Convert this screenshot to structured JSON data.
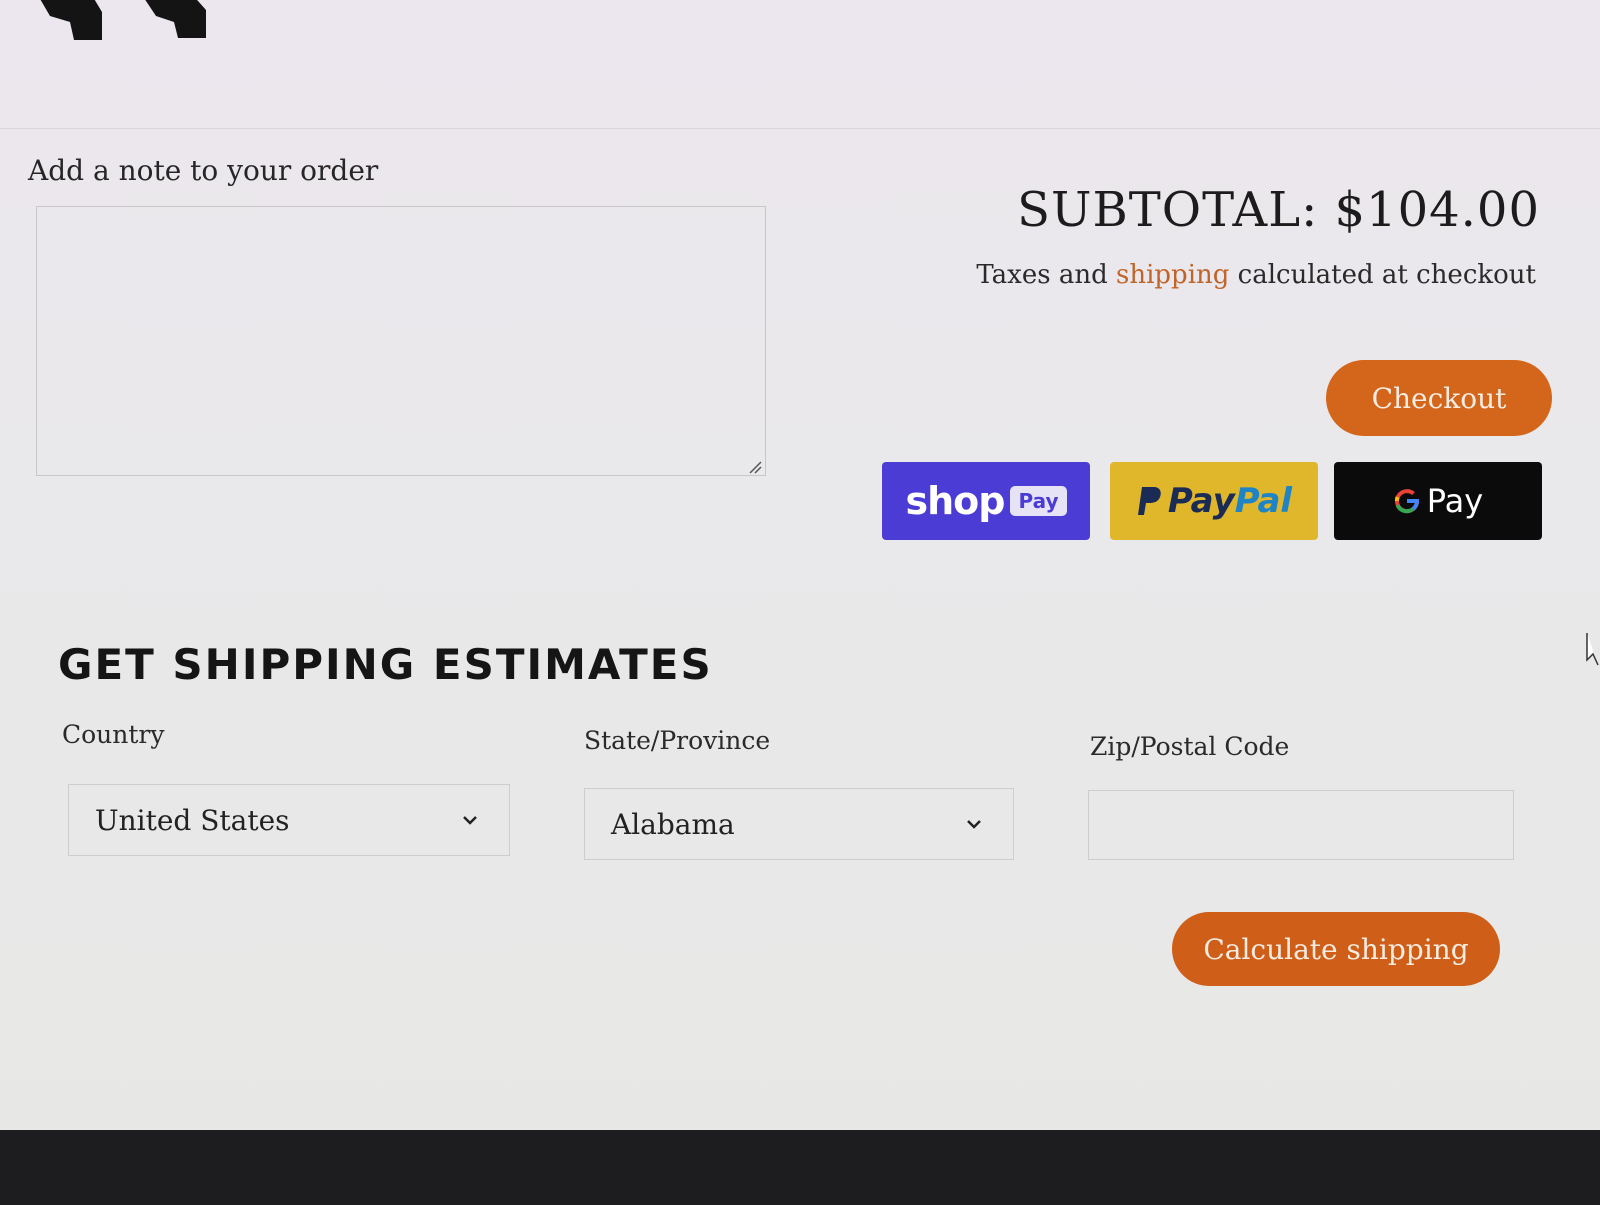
{
  "note": {
    "label": "Add a note to your order",
    "value": ""
  },
  "summary": {
    "subtotal": "SUBTOTAL: $104.00",
    "tax_prefix": "Taxes and ",
    "tax_link": "shipping",
    "tax_suffix": " calculated at checkout"
  },
  "checkout_label": "Checkout",
  "payment_buttons": {
    "shoppay_shop": "shop",
    "shoppay_pay": "Pay",
    "paypal_a": "Pay",
    "paypal_b": "Pal",
    "gpay_label": "Pay"
  },
  "shipping": {
    "title": "GET SHIPPING ESTIMATES",
    "country_label": "Country",
    "country_value": "United States",
    "state_label": "State/Province",
    "state_value": "Alabama",
    "zip_label": "Zip/Postal Code",
    "zip_value": "",
    "calculate_label": "Calculate shipping"
  },
  "colors": {
    "accent": "#d4661c",
    "shoppay": "#4b3cd6",
    "paypal": "#e0b72b",
    "gpay": "#0b0b0b",
    "link": "#c0652a"
  }
}
